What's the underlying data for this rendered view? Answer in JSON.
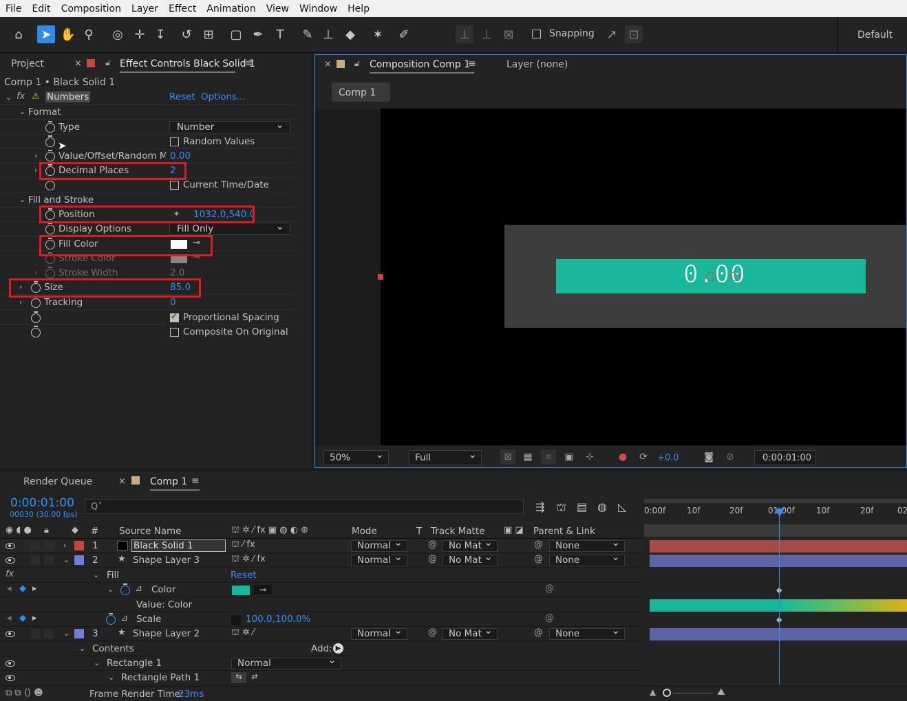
{
  "menu": [
    "File",
    "Edit",
    "Composition",
    "Layer",
    "Effect",
    "Animation",
    "View",
    "Window",
    "Help"
  ],
  "toolbar": {
    "snapping": "Snapping",
    "workspace": "Default"
  },
  "project_tab": "Project",
  "effect_tab": "Effect Controls Black Solid 1",
  "effect_path": "Comp 1 • Black Solid 1",
  "effect": {
    "name": "Numbers",
    "reset": "Reset",
    "options": "Options...",
    "format": "Format",
    "type_label": "Type",
    "type_value": "Number",
    "random_values": "Random Values",
    "value_offset_label": "Value/Offset/Random Ma",
    "value_offset": "0.00",
    "decimal_label": "Decimal Places",
    "decimal_value": "2",
    "current_time": "Current Time/Date",
    "fill_stroke": "Fill and Stroke",
    "position_label": "Position",
    "position_value": "1032.0,540.0",
    "display_label": "Display Options",
    "display_value": "Fill Only",
    "fill_color_label": "Fill Color",
    "stroke_color_label": "Stroke Color",
    "stroke_width_label": "Stroke Width",
    "stroke_width_value": "2.0",
    "size_label": "Size",
    "size_value": "85.0",
    "tracking_label": "Tracking",
    "tracking_value": "0",
    "proportional": "Proportional Spacing",
    "composite": "Composite On Original"
  },
  "comp_tab": "Composition Comp 1",
  "layer_tab": "Layer (none)",
  "comp_crumb": "Comp 1",
  "viewer": {
    "number_text": "0.00",
    "zoom": "50%",
    "resolution": "Full",
    "exposure": "+0.0",
    "timecode": "0:00:01:00"
  },
  "timeline": {
    "render_queue": "Render Queue",
    "comp_tab": "Comp 1",
    "time": "0:00:01:00",
    "frames": "00030 (30.00 fps)",
    "search_placeholder": "Q˅",
    "ruler": [
      "0:00f",
      "10f",
      "20f",
      "01:00f",
      "10f",
      "20f",
      "02"
    ],
    "headers": {
      "num": "#",
      "source": "Source Name",
      "mode": "Mode",
      "t": "T",
      "track": "Track Matte",
      "parent": "Parent & Link"
    },
    "rows": {
      "l1_num": "1",
      "l1_name": "Black Solid 1",
      "l1_mode": "Normal",
      "l1_track": "No Mat",
      "l1_parent": "None",
      "l2_num": "2",
      "l2_name": "Shape Layer 3",
      "l2_mode": "Normal",
      "l2_track": "No Mat",
      "l2_parent": "None",
      "fill": "Fill",
      "fill_reset": "Reset",
      "color": "Color",
      "value_color": "Value: Color",
      "scale": "Scale",
      "scale_value": "100.0,100.0%",
      "l3_num": "3",
      "l3_name": "Shape Layer 2",
      "l3_mode": "Normal",
      "l3_track": "No Mat",
      "l3_parent": "None",
      "contents": "Contents",
      "add": "Add:",
      "rectangle": "Rectangle 1",
      "rect_mode": "Normal",
      "rect_path": "Rectangle Path 1"
    },
    "frame_render_label": "Frame Render Time:",
    "frame_render_value": "23ms"
  },
  "colors": {
    "accent": "#2f8ff5",
    "teal": "#17b79a",
    "highlight": "#e01b22"
  }
}
